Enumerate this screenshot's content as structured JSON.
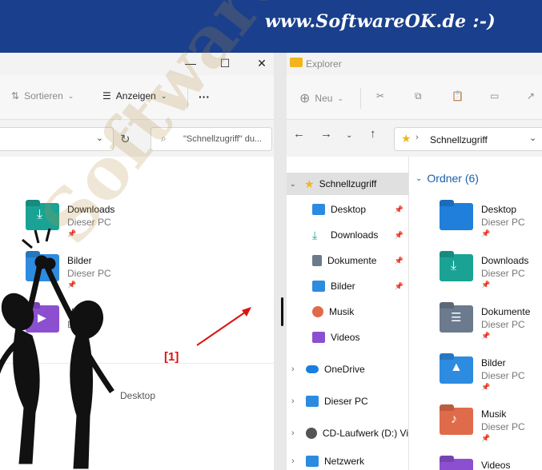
{
  "banner": {
    "text": "www.SoftwareOK.de :-)"
  },
  "left_window": {
    "toolbar": {
      "sort_label": "Sortieren",
      "view_label": "Anzeigen",
      "more_label": "···"
    },
    "search_placeholder": "\"Schnellzugriff\" du...",
    "items": [
      {
        "name": "Downloads",
        "location": "Dieser PC",
        "color": "#1aa394"
      },
      {
        "name": "Bilder",
        "location": "Dieser PC",
        "color": "#2d8be0"
      },
      {
        "name": "Videos",
        "location": "Di",
        "color": "#8c4fd0"
      }
    ],
    "recent_label": "Desktop"
  },
  "right_window": {
    "title": "Explorer",
    "toolbar": {
      "new_label": "Neu"
    },
    "breadcrumb": "Schnellzugriff",
    "tree": [
      {
        "label": "Schnellzugriff",
        "color": "#f2b51c"
      },
      {
        "label": "Desktop",
        "color": "#2b8be0"
      },
      {
        "label": "Downloads",
        "color": "#1aa394"
      },
      {
        "label": "Dokumente",
        "color": "#6b7a8d"
      },
      {
        "label": "Bilder",
        "color": "#2d8be0"
      },
      {
        "label": "Musik",
        "color": "#e06b4a"
      },
      {
        "label": "Videos",
        "color": "#8c4fd0"
      },
      {
        "label": "OneDrive",
        "color": "#1b7fe0"
      },
      {
        "label": "Dieser PC",
        "color": "#2b8be0"
      },
      {
        "label": "CD-Laufwerk (D:) Vi",
        "color": "#555555"
      },
      {
        "label": "Netzwerk",
        "color": "#2b8be0"
      }
    ],
    "group_header": "Ordner (6)",
    "folders": [
      {
        "name": "Desktop",
        "location": "Dieser PC",
        "color": "#1f7fdb"
      },
      {
        "name": "Downloads",
        "location": "Dieser PC",
        "color": "#1aa394"
      },
      {
        "name": "Dokumente",
        "location": "Dieser PC",
        "color": "#6b7a8d"
      },
      {
        "name": "Bilder",
        "location": "Dieser PC",
        "color": "#2d8be0"
      },
      {
        "name": "Musik",
        "location": "Dieser PC",
        "color": "#e06b4a"
      },
      {
        "name": "Videos",
        "location": "",
        "color": "#8c4fd0"
      }
    ]
  },
  "annotation": {
    "tag": "[1]",
    "watermark": "SoftwareOK.de"
  }
}
